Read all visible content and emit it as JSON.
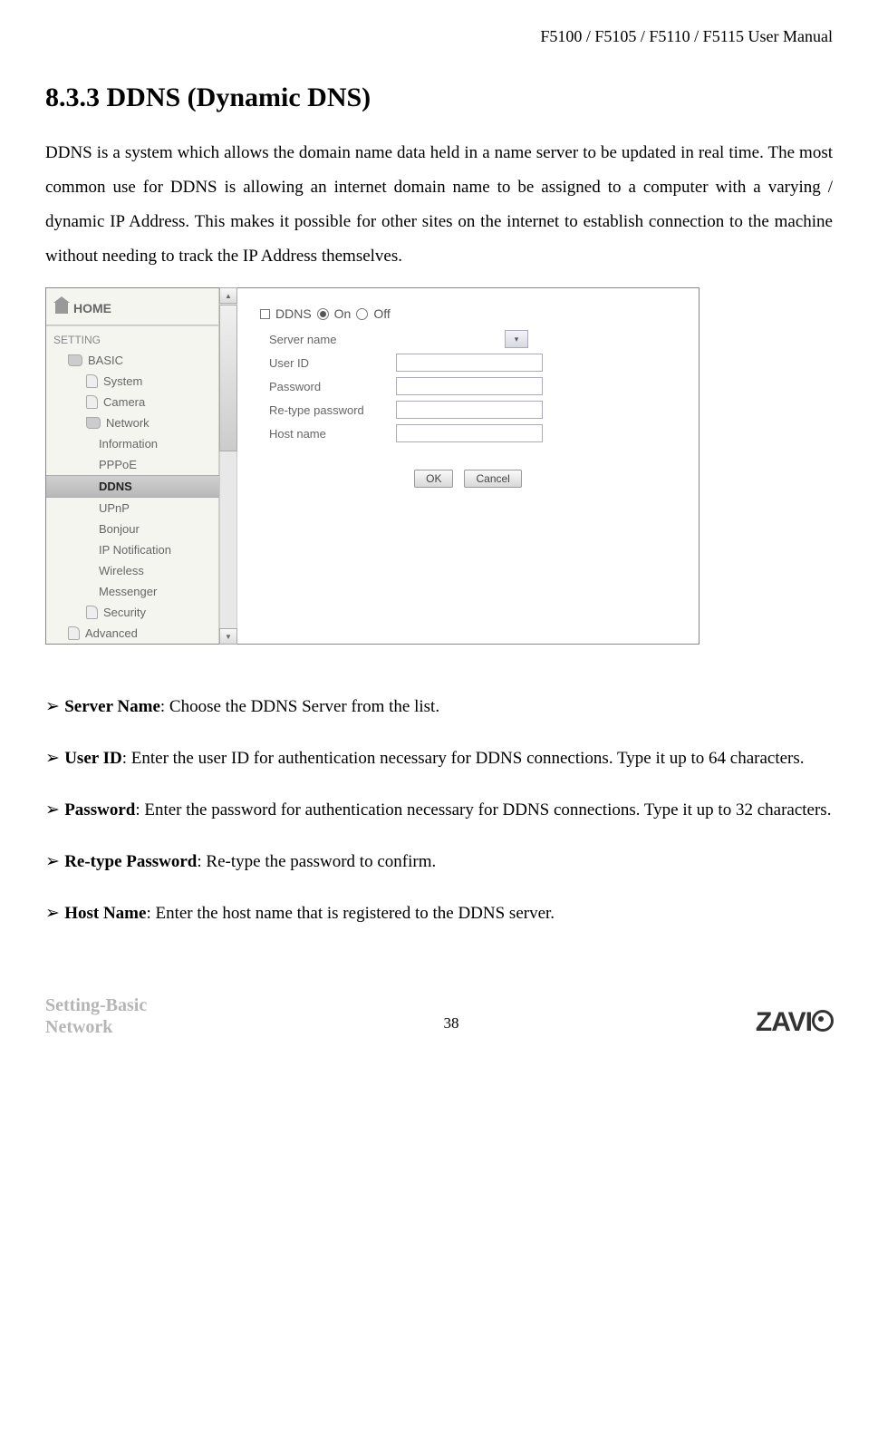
{
  "header": "F5100 / F5105 / F5110 / F5115 User Manual",
  "section_heading": "8.3.3 DDNS (Dynamic DNS)",
  "intro": "DDNS is a system which allows the domain name data held in a name server to be updated in real time. The most common use for DDNS is allowing an internet domain name to be assigned to a computer with a varying / dynamic IP Address. This makes it possible for other sites on the internet to establish connection to the machine without needing to track the IP Address themselves.",
  "ui": {
    "home": "HOME",
    "setting": "SETTING",
    "basic": "BASIC",
    "basic_children": [
      "System",
      "Camera",
      "Network"
    ],
    "network_children": [
      "Information",
      "PPPoE",
      "DDNS",
      "UPnP",
      "Bonjour",
      "IP Notification",
      "Wireless",
      "Messenger"
    ],
    "security": "Security",
    "advanced": "Advanced",
    "form": {
      "title": "DDNS",
      "on": "On",
      "off": "Off",
      "rows": [
        "Server name",
        "User ID",
        "Password",
        "Re-type password",
        "Host name"
      ],
      "ok": "OK",
      "cancel": "Cancel"
    }
  },
  "bullets": [
    {
      "term": "Server Name",
      "text": ": Choose the DDNS Server from the list."
    },
    {
      "term": "User ID",
      "text": ": Enter the user ID for authentication necessary for DDNS connections. Type it up to 64 characters."
    },
    {
      "term": "Password",
      "text": ": Enter the password for authentication necessary for DDNS connections. Type it up to 32 characters."
    },
    {
      "term": "Re-type Password",
      "text": ": Re-type the password to confirm."
    },
    {
      "term": "Host Name",
      "text": ": Enter the host name that is registered to the DDNS server."
    }
  ],
  "footer": {
    "section_path_1": "Setting-Basic",
    "section_path_2": "Network",
    "page_no": "38",
    "brand": "ZAVI"
  }
}
